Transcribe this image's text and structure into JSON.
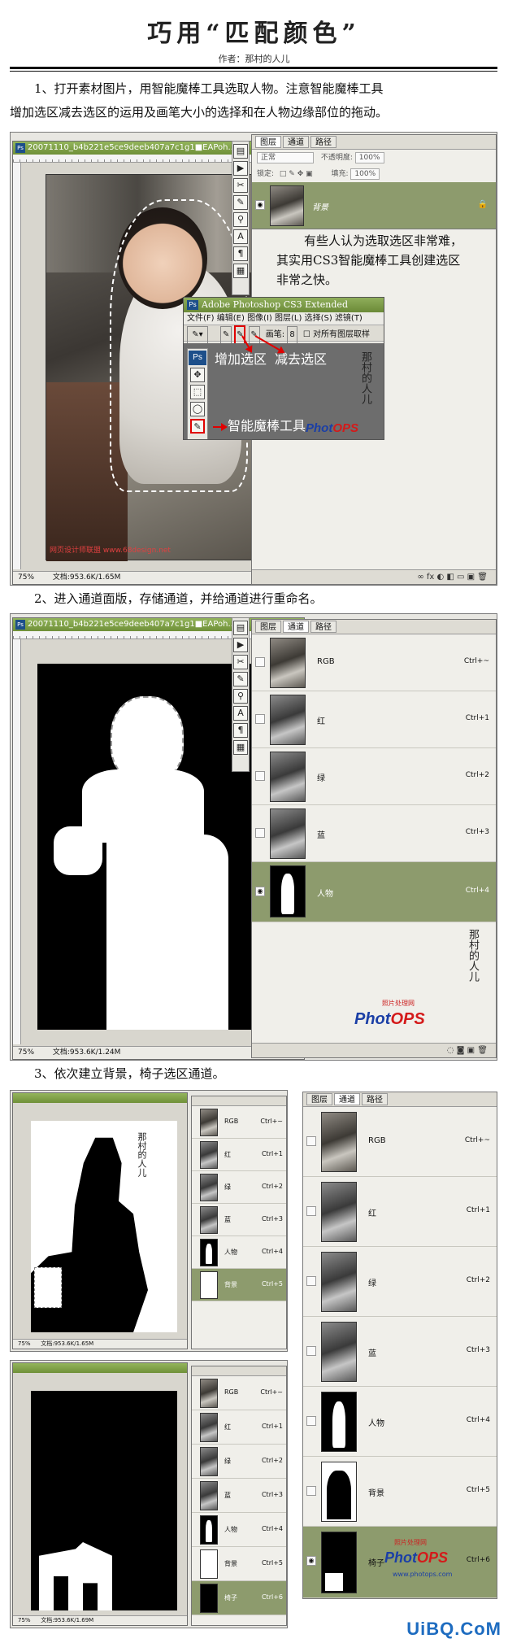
{
  "header": {
    "title": "巧用“匹配颜色”",
    "author": "作者：那村的人儿"
  },
  "steps": {
    "s1_line1": "1、打开素材图片，用智能魔棒工具选取人物。注意智能魔棒工具",
    "s1_line2": "增加选区减去选区的运用及画笔大小的选择和在人物边缘部位的拖动。",
    "s2": "2、进入通道面版，存储通道，并给通道进行重命名。",
    "s3": "3、依次建立背景，椅子选区通道。"
  },
  "shot1": {
    "doc_title": "20071110_b4b221e5ce9deeb407a7c1g1■EAPoh...",
    "zoom": "75%",
    "doc_size": "文档:953.6K/1.65M",
    "watermark": "网页设计师联盟 www.68design.net",
    "panel_tabs": [
      "图层",
      "通道",
      "路径"
    ],
    "blend_mode": "正常",
    "opacity_label": "不透明度:",
    "opacity_value": "100%",
    "lock_label": "锁定:",
    "fill_label": "填充:",
    "fill_value": "100%",
    "layer_name": "背景",
    "callout": "有些人认为选取选区非常难，其实用CS3智能魔棒工具创建选区非常之快。",
    "popup_title": "Adobe Photoshop CS3 Extended",
    "popup_menu": [
      "文件(F)",
      "编辑(E)",
      "图像(I)",
      "图层(L)",
      "选择(S)",
      "滤镜(T)"
    ],
    "brush_label": "画笔:",
    "brush_size": "8",
    "sample_all": "对所有图层取样",
    "add_selection": "增加选区",
    "subtract_selection": "减去选区",
    "smart_wand": "智能魔棒工具",
    "ps_badge": "Ps"
  },
  "shot2": {
    "doc_title": "20071110_b4b221e5ce9deeb407a7c1g1■EAPoh...",
    "zoom": "75%",
    "doc_size": "文档:953.6K/1.24M",
    "panel_tabs": [
      "图层",
      "通道",
      "路径"
    ],
    "channels": [
      {
        "name": "RGB",
        "shortcut": "Ctrl+~"
      },
      {
        "name": "红",
        "shortcut": "Ctrl+1"
      },
      {
        "name": "绿",
        "shortcut": "Ctrl+2"
      },
      {
        "name": "蓝",
        "shortcut": "Ctrl+3"
      },
      {
        "name": "人物",
        "shortcut": "Ctrl+4"
      }
    ],
    "logo_small": "照片处理网",
    "logo": "PhotOPS"
  },
  "shot3": {
    "doc_size_a": "文档:953.6K/1.65M",
    "doc_size_b": "文档:953.6K/1.69M",
    "zoom": "75%",
    "small_channels_a": [
      {
        "name": "RGB",
        "shortcut": "Ctrl+~"
      },
      {
        "name": "红",
        "shortcut": "Ctrl+1"
      },
      {
        "name": "绿",
        "shortcut": "Ctrl+2"
      },
      {
        "name": "蓝",
        "shortcut": "Ctrl+3"
      },
      {
        "name": "人物",
        "shortcut": "Ctrl+4"
      },
      {
        "name": "背景",
        "shortcut": "Ctrl+5"
      }
    ],
    "small_channels_b": [
      {
        "name": "RGB",
        "shortcut": "Ctrl+~"
      },
      {
        "name": "红",
        "shortcut": "Ctrl+1"
      },
      {
        "name": "绿",
        "shortcut": "Ctrl+2"
      },
      {
        "name": "蓝",
        "shortcut": "Ctrl+3"
      },
      {
        "name": "人物",
        "shortcut": "Ctrl+4"
      },
      {
        "name": "背景",
        "shortcut": "Ctrl+5"
      },
      {
        "name": "椅子",
        "shortcut": "Ctrl+6"
      }
    ],
    "big_tabs": [
      "图层",
      "通道",
      "路径"
    ],
    "big_channels": [
      {
        "name": "RGB",
        "shortcut": "Ctrl+~"
      },
      {
        "name": "红",
        "shortcut": "Ctrl+1"
      },
      {
        "name": "绿",
        "shortcut": "Ctrl+2"
      },
      {
        "name": "蓝",
        "shortcut": "Ctrl+3"
      },
      {
        "name": "人物",
        "shortcut": "Ctrl+4"
      },
      {
        "name": "背景",
        "shortcut": "Ctrl+5"
      },
      {
        "name": "椅子",
        "shortcut": "Ctrl+6"
      }
    ],
    "logo_small": "照片处理网",
    "logo": "PhotOPS",
    "logo_url": "www.photops.com"
  },
  "footer": {
    "watermark": "UiBQ.CoM"
  },
  "colors": {
    "active_row": "#8d9b6d",
    "titlebar": "#7a9a45",
    "annotation_red": "#e00000",
    "logo_blue": "#1b3fa6"
  }
}
